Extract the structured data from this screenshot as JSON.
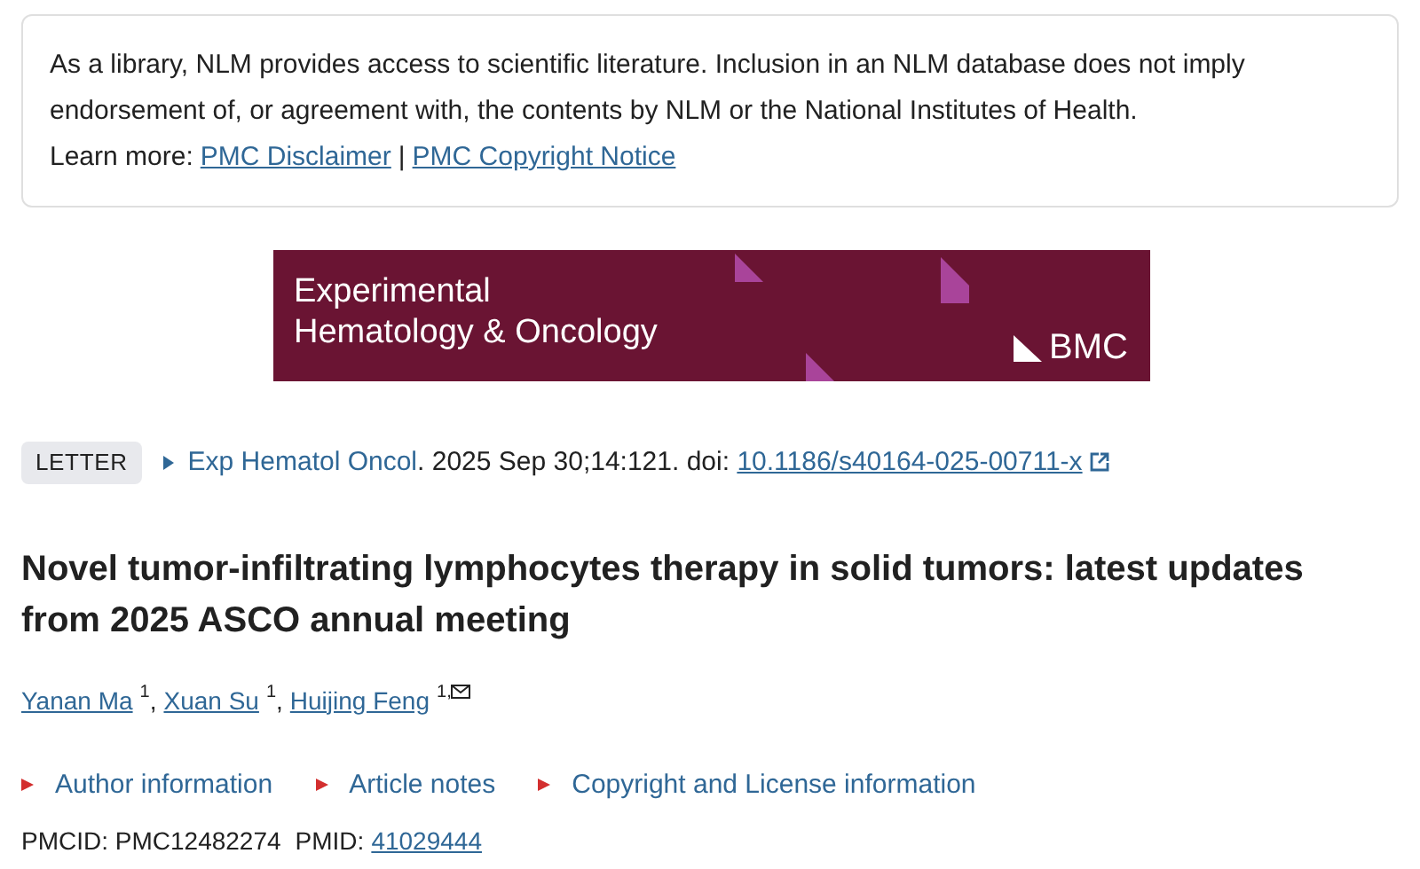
{
  "notice": {
    "text": "As a library, NLM provides access to scientific literature. Inclusion in an NLM database does not imply endorsement of, or agreement with, the contents by NLM or the National Institutes of Health.",
    "learn_more_label": "Learn more:",
    "links": [
      "PMC Disclaimer",
      "PMC Copyright Notice"
    ],
    "separator": "|"
  },
  "banner": {
    "journal_lines": [
      "Experimental",
      "Hematology & Oncology"
    ],
    "publisher": "BMC"
  },
  "citation": {
    "type_badge": "LETTER",
    "journal": "Exp Hematol Oncol",
    "details": ". 2025 Sep 30;14:121. doi: ",
    "doi": "10.1186/s40164-025-00711-x"
  },
  "title": "Novel tumor-infiltrating lymphocytes therapy in solid tumors: latest updates from 2025 ASCO annual meeting",
  "authors": [
    {
      "name": "Yanan Ma",
      "affiliation": "1",
      "corresponding": false
    },
    {
      "name": "Xuan Su",
      "affiliation": "1",
      "corresponding": false
    },
    {
      "name": "Huijing Feng",
      "affiliation": "1,",
      "corresponding": true
    }
  ],
  "author_separator": ",",
  "sections": [
    {
      "label": "Author information",
      "expanded": false
    },
    {
      "label": "Article notes",
      "expanded": false
    },
    {
      "label": "Copyright and License information",
      "expanded": false
    }
  ],
  "ids": {
    "pmcid_label": "PMCID:",
    "pmcid": "PMC12482274",
    "pmid_label": "PMID:",
    "pmid": "41029444"
  }
}
